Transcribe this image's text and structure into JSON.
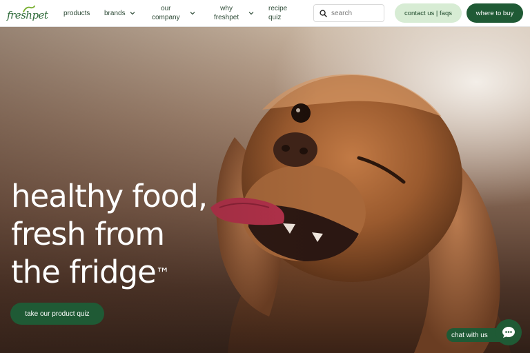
{
  "brand": {
    "logo_text": "freshpet",
    "color": "#1f5a35"
  },
  "nav": {
    "products": "products",
    "brands": "brands",
    "our_company": [
      "our",
      "company"
    ],
    "why_freshpet": [
      "why",
      "freshpet"
    ],
    "recipe_quiz": [
      "recipe",
      "quiz"
    ]
  },
  "search": {
    "placeholder": "search",
    "icon": "search-icon"
  },
  "header_buttons": {
    "contact": "contact us | faqs",
    "where_to_buy": "where to buy"
  },
  "hero": {
    "headline": [
      "healthy food,",
      "fresh from",
      "the fridge"
    ],
    "trademark": "™",
    "cta": "take our product quiz"
  },
  "chat": {
    "label": "chat with us",
    "icon": "chat-bubble-icon"
  },
  "colors": {
    "dark_green": "#1f5a35",
    "light_green": "#d7ecd4",
    "nav_text": "#2d4a36"
  }
}
